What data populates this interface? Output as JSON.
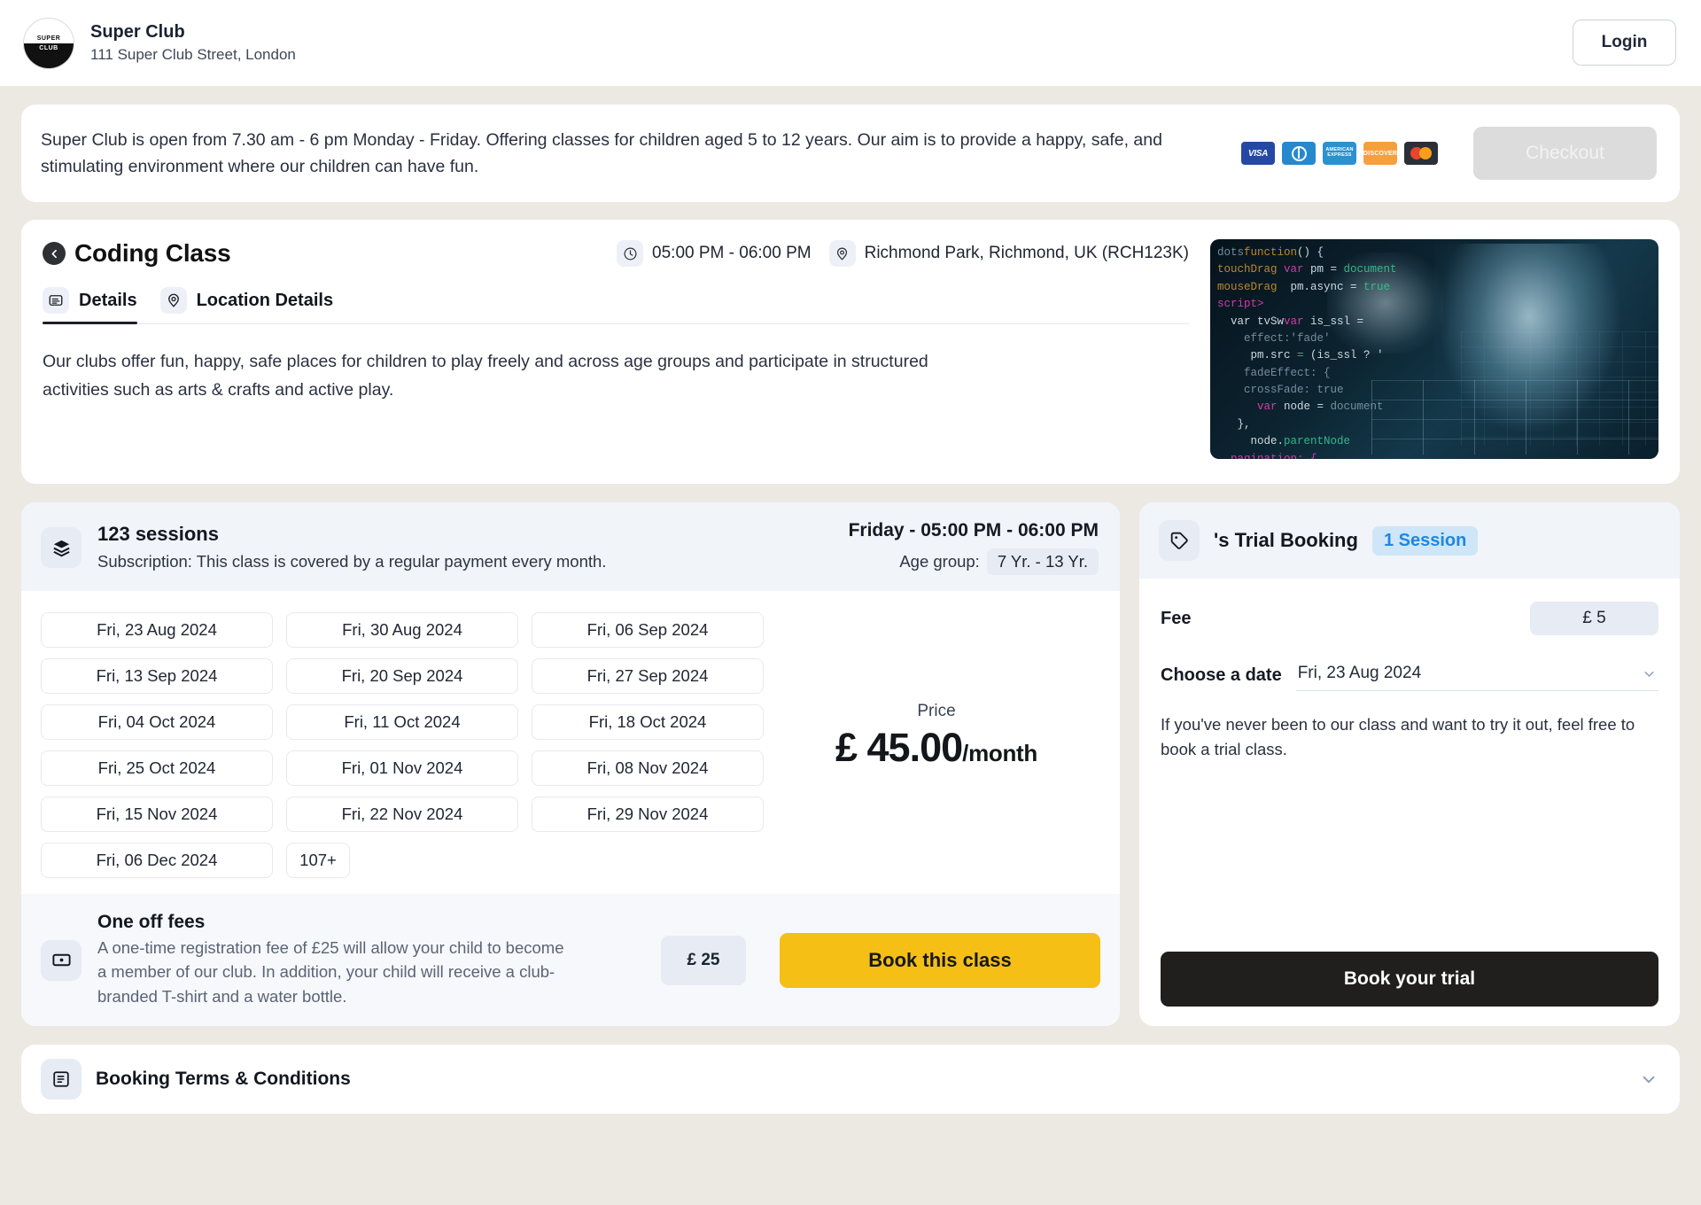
{
  "header": {
    "logo_top_text": "SUPER",
    "logo_bottom_text": "CLUB",
    "club_name": "Super Club",
    "club_address": "111 Super Club Street, London",
    "login_label": "Login"
  },
  "banner": {
    "text": "Super Club is open from 7.30 am - 6 pm Monday - Friday. Offering classes for children aged 5 to 12 years. Our aim is to provide a happy, safe, and stimulating environment where our children can have fun.",
    "payment_methods": [
      "VISA",
      "Diners Club",
      "AMERICAN EXPRESS",
      "DISCOVER",
      "Mastercard"
    ],
    "checkout_label": "Checkout",
    "checkout_disabled": true
  },
  "class": {
    "title": "Coding Class",
    "time": "05:00 PM - 06:00 PM",
    "location": "Richmond Park, Richmond, UK (RCH123K)",
    "tabs": [
      {
        "label": "Details",
        "icon": "details-icon",
        "active": true
      },
      {
        "label": "Location Details",
        "icon": "location-pin-icon",
        "active": false
      }
    ],
    "description": "Our clubs offer fun, happy, safe places for children to play freely and across age groups and participate in structured activities such as arts & crafts and active play.",
    "image_alt": "child-coding-photo"
  },
  "sessions": {
    "count_label": "123 sessions",
    "subscription_note": "Subscription: This class is covered by a regular payment every month.",
    "schedule": "Friday - 05:00 PM - 06:00 PM",
    "age_group_label": "Age group:",
    "age_group_value": "7 Yr. - 13 Yr.",
    "dates": [
      "Fri, 23 Aug 2024",
      "Fri, 30 Aug 2024",
      "Fri, 06 Sep 2024",
      "Fri, 13 Sep 2024",
      "Fri, 20 Sep 2024",
      "Fri, 27 Sep 2024",
      "Fri, 04 Oct 2024",
      "Fri, 11 Oct 2024",
      "Fri, 18 Oct 2024",
      "Fri, 25 Oct 2024",
      "Fri, 01 Nov 2024",
      "Fri, 08 Nov 2024",
      "Fri, 15 Nov 2024",
      "Fri, 22 Nov 2024",
      "Fri, 29 Nov 2024",
      "Fri, 06 Dec 2024"
    ],
    "more_label": "107+",
    "price_label": "Price",
    "price_amount": "£ 45.00",
    "price_period": "/month"
  },
  "one_off_fees": {
    "title": "One off fees",
    "text": "A one-time registration fee of £25 will allow your child to become a member of our club. In addition, your child will receive a club-branded T-shirt and a water bottle.",
    "amount": "£ 25",
    "book_label": "Book this class"
  },
  "trial": {
    "title": "'s Trial Booking",
    "session_badge": "1 Session",
    "fee_label": "Fee",
    "fee_value": "£ 5",
    "date_label": "Choose a date",
    "date_value": "Fri, 23 Aug 2024",
    "description": "If you've never been to our class and want to try it out, feel free to book a trial class.",
    "book_label": "Book your trial"
  },
  "terms": {
    "title": "Booking Terms & Conditions"
  },
  "colors": {
    "page_bg": "#ece9e3",
    "accent_yellow": "#f5bf16",
    "dark_button": "#201f1e",
    "badge_blue_bg": "#cfe6f8",
    "badge_blue_text": "#1f86e0",
    "panel_grey": "#f1f4f9"
  }
}
